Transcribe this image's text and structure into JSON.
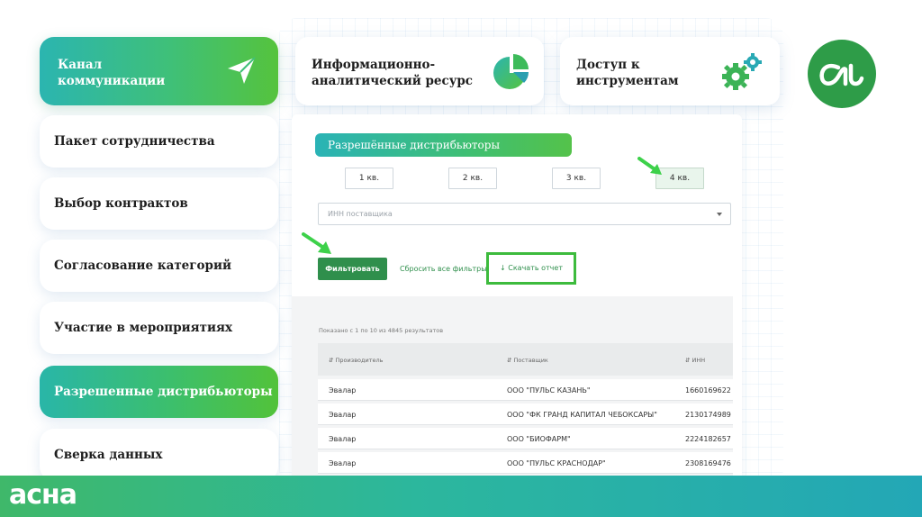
{
  "sidebar": {
    "channel": "Канал коммуникации",
    "items": [
      {
        "label": "Пакет сотрудничества"
      },
      {
        "label": "Выбор контрактов"
      },
      {
        "label": "Согласование категорий"
      },
      {
        "label": "Участие в мероприятиях"
      },
      {
        "label": "Разрешенные дистрибьюторы",
        "active": true
      },
      {
        "label": "Сверка данных"
      }
    ]
  },
  "top_cards": {
    "info_resource": "Информационно-аналитический ресурс",
    "tools_access": "Доступ к инструментам"
  },
  "panel": {
    "title": "Разрешённые дистрибьюторы",
    "quarters": [
      "1 кв.",
      "2 кв.",
      "3 кв.",
      "4 кв."
    ],
    "selected_quarter": "4 кв.",
    "inn_placeholder": "ИНН поставщика",
    "filter_button": "Фильтровать",
    "reset_link": "Сбросить все фильтры",
    "download_link": "Скачать отчет",
    "results_text": "Показано с 1 по 10 из 4845 результатов",
    "columns": [
      "Производитель",
      "Поставщик",
      "ИНН"
    ],
    "rows": [
      {
        "manufacturer": "Эвалар",
        "supplier": "ООО \"ПУЛЬС КАЗАНЬ\"",
        "inn": "1660169622"
      },
      {
        "manufacturer": "Эвалар",
        "supplier": "ООО \"ФК ГРАНД КАПИТАЛ ЧЕБОКСАРЫ\"",
        "inn": "2130174989"
      },
      {
        "manufacturer": "Эвалар",
        "supplier": "ООО \"БИОФАРМ\"",
        "inn": "2224182657"
      },
      {
        "manufacturer": "Эвалар",
        "supplier": "ООО \"ПУЛЬС КРАСНОДАР\"",
        "inn": "2308169476"
      }
    ]
  },
  "brand": {
    "footer_logo": "асна",
    "primary_color": "#2f8f4c",
    "accent_green": "#3dbb3d",
    "logo_icon": "asna-monogram-icon"
  }
}
